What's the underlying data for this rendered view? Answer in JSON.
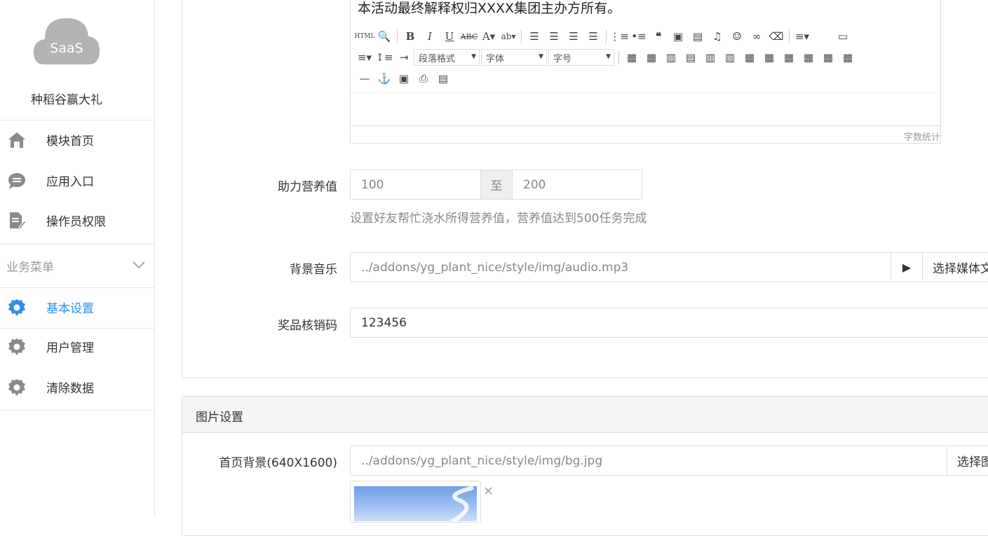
{
  "sidebar": {
    "logo_text": "SaaS",
    "brand": "种稻谷赢大礼",
    "items": [
      {
        "label": "模块首页",
        "icon": "home-icon"
      },
      {
        "label": "应用入口",
        "icon": "chat-icon"
      },
      {
        "label": "操作员权限",
        "icon": "edit-doc-icon"
      }
    ],
    "group_title": "业务菜单",
    "group_items": [
      {
        "label": "基本设置",
        "icon": "gear-icon",
        "active": true
      },
      {
        "label": "用户管理",
        "icon": "gear-icon"
      },
      {
        "label": "清除数据",
        "icon": "gear-icon"
      }
    ],
    "active_color": "#2f8ee6"
  },
  "editor": {
    "content": "本活动最终解释权归XXXX集团主办方所有。",
    "paragraph_format": "段落格式",
    "font_family": "字体",
    "font_size": "字号",
    "word_count": "字数统计"
  },
  "form": {
    "nutrition": {
      "label": "助力营养值",
      "min": "100",
      "to": "至",
      "max": "200",
      "help": "设置好友帮忙浇水所得营养值，营养值达到500任务完成"
    },
    "music": {
      "label": "背景音乐",
      "value": "../addons/yg_plant_nice/style/img/audio.mp3",
      "play": "▶",
      "select": "选择媒体文件"
    },
    "code": {
      "label": "奖品核销码",
      "value": "123456"
    }
  },
  "image_panel": {
    "title": "图片设置",
    "bg": {
      "label": "首页背景(640X1600)",
      "value": "../addons/yg_plant_nice/style/img/bg.jpg",
      "select": "选择图片"
    },
    "remove": "×"
  }
}
